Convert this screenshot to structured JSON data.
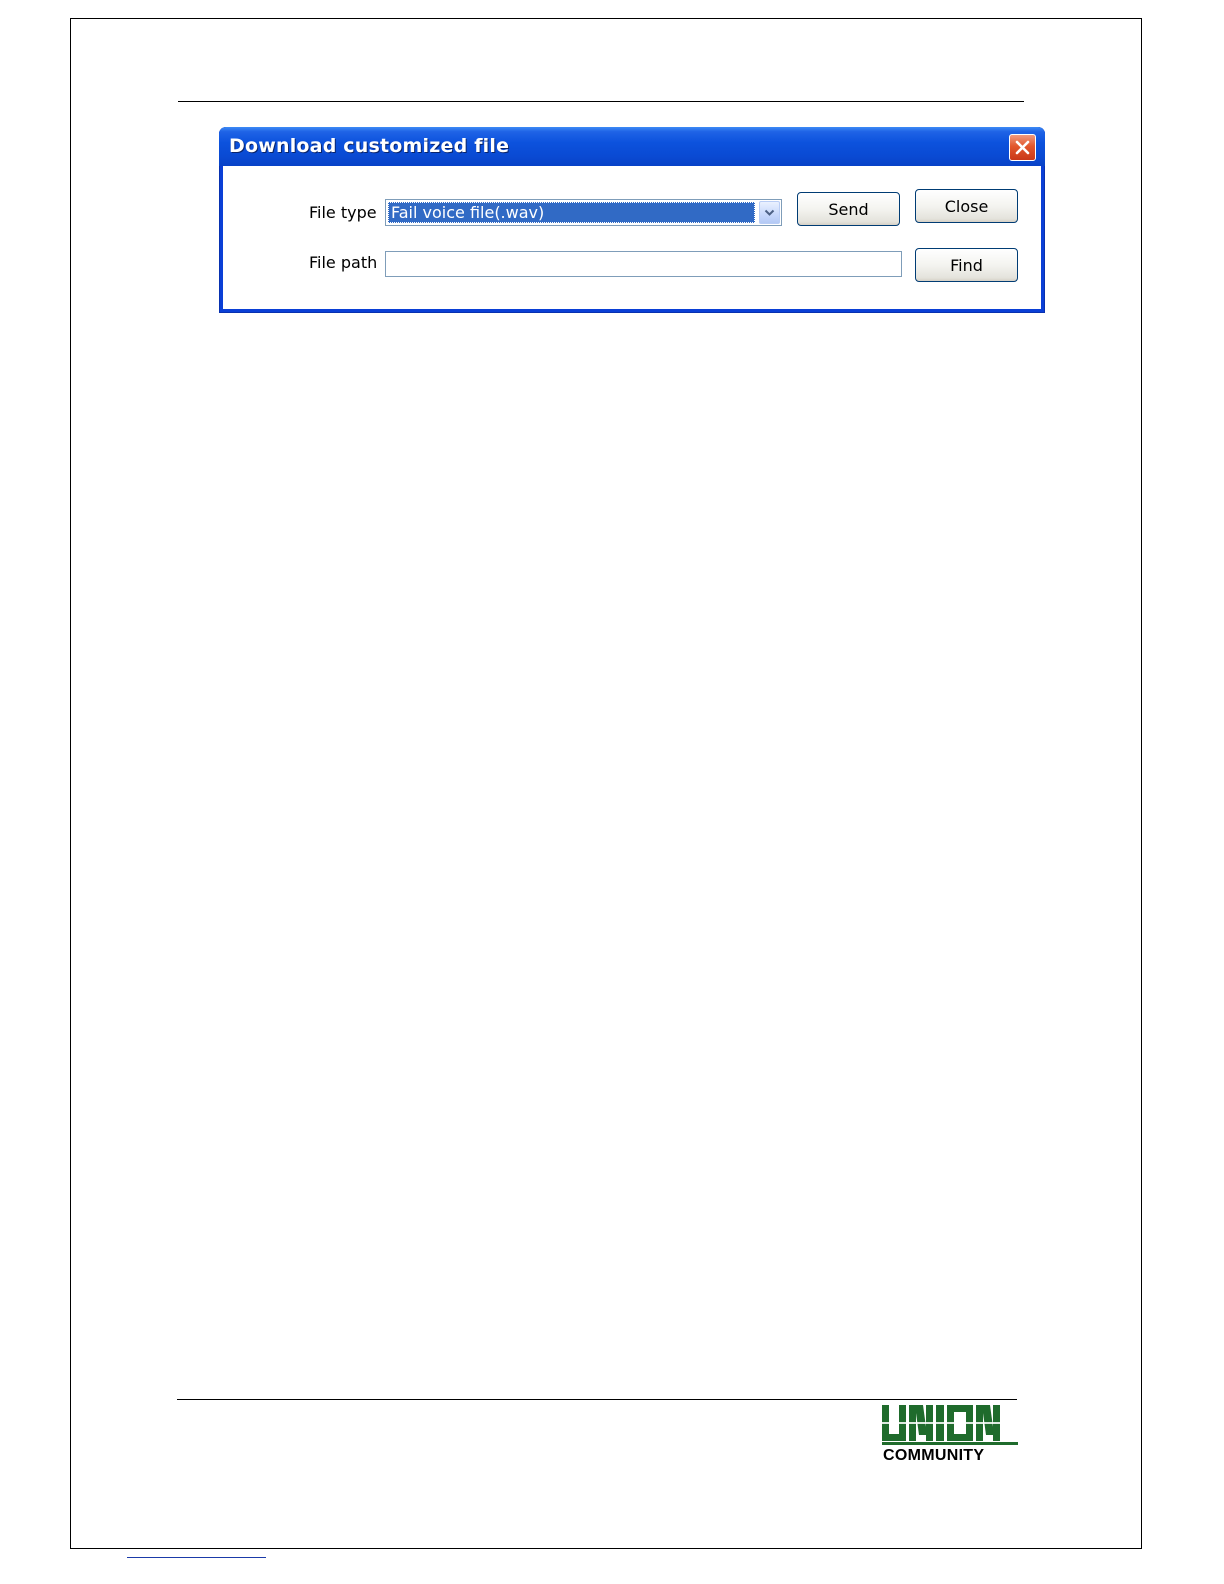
{
  "dialog": {
    "title": "Download customized file",
    "file_type_label": "File type",
    "file_type_selected": "Fail voice file(.wav)",
    "file_path_label": "File path",
    "file_path_value": "",
    "send_label": "Send",
    "close_label": "Close",
    "find_label": "Find",
    "icons": {
      "close": "close-icon",
      "dropdown": "chevron-down-icon"
    }
  },
  "logo": {
    "wordmark": "UNION",
    "subtext": "COMMUNITY",
    "brand_color": "#1f6b2c"
  },
  "colors": {
    "titlebar": "#0a4ad3",
    "selection": "#316ac5",
    "close_button": "#e2562c"
  }
}
